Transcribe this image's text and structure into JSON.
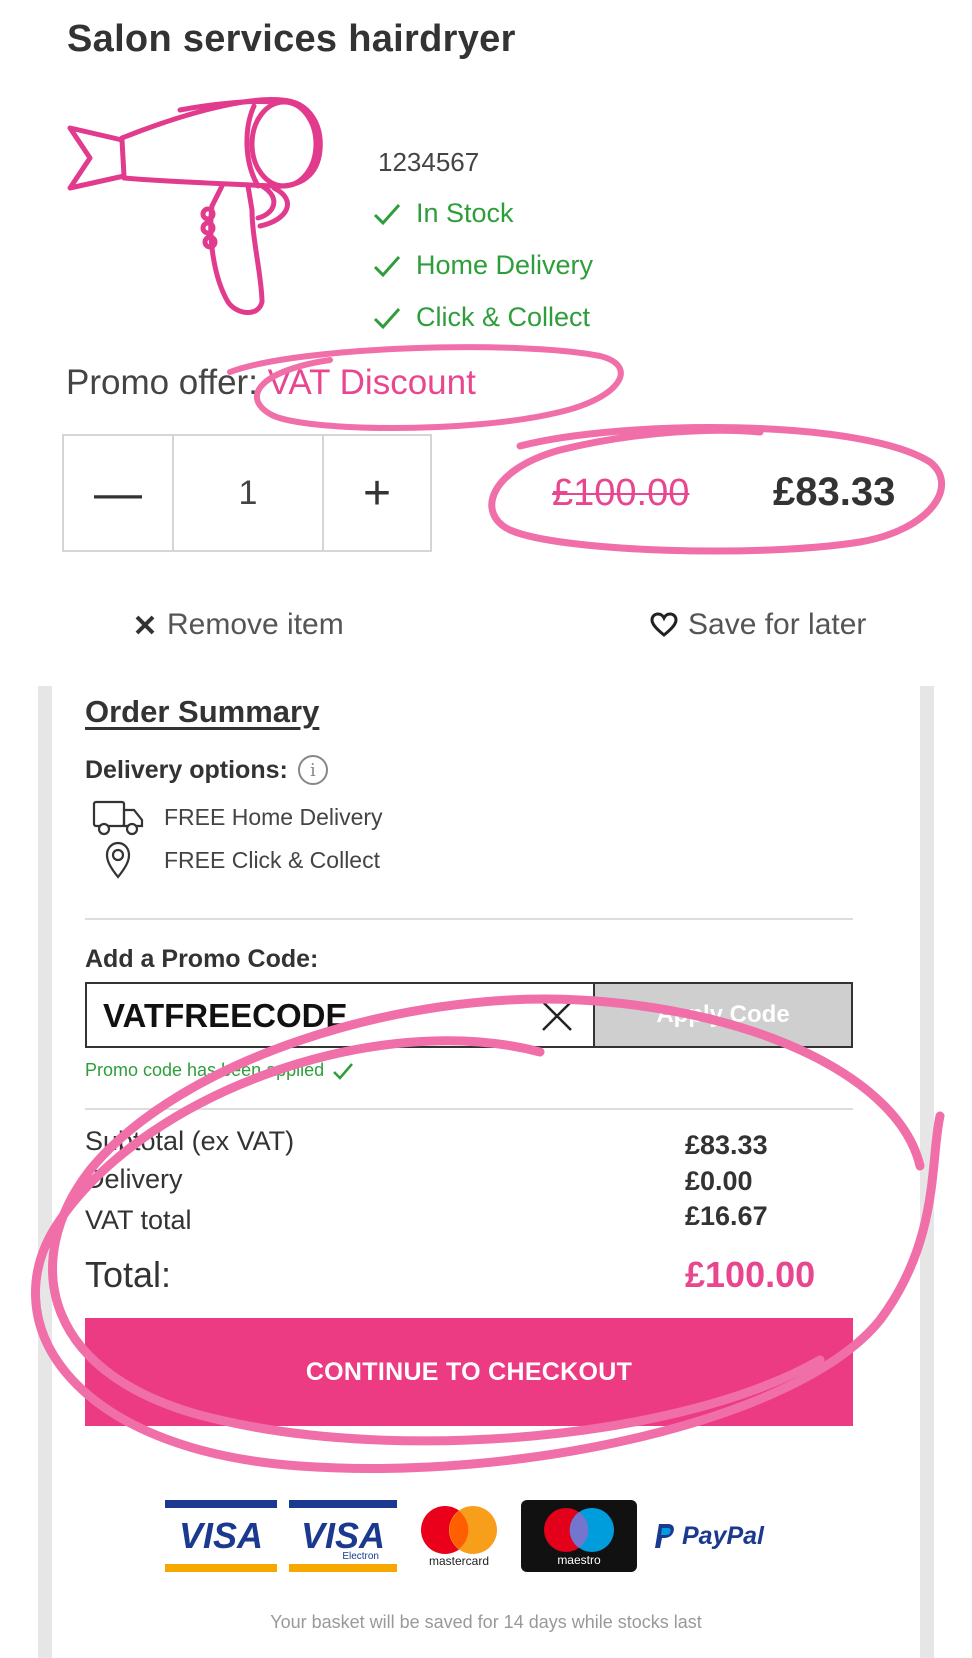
{
  "product": {
    "title": "Salon services hairdryer",
    "sku": "1234567",
    "stock_items": [
      "In Stock",
      "Home Delivery",
      "Click & Collect"
    ],
    "promo_offer_label": "Promo offer: ",
    "promo_offer_value": "VAT Discount",
    "quantity": "1",
    "minus_symbol": "—",
    "plus_symbol": "+",
    "old_price": "£100.00",
    "new_price": "£83.33",
    "remove_label": "Remove item",
    "save_label": "Save for later"
  },
  "summary": {
    "title": "Order Summary",
    "delivery_title": "Delivery options:",
    "info_symbol": "i",
    "delivery_options": [
      "FREE Home Delivery",
      "FREE Click & Collect"
    ],
    "promo_label": "Add a Promo Code:",
    "promo_code_value": "VATFREECODE",
    "apply_label": "Apply Code",
    "promo_status": "Promo code has been applied",
    "subtotal_label": "Subtotal (ex VAT)",
    "subtotal_value": "£83.33",
    "delivery_label": "Delivery",
    "delivery_value": "£0.00",
    "vat_label": "VAT total",
    "vat_value": "£16.67",
    "total_label": "Total:",
    "total_value": "£100.00",
    "checkout_label": "CONTINUE TO CHECKOUT"
  },
  "payment": {
    "visa": "VISA",
    "visa_electron": "VISA",
    "visa_electron_sub": "Electron",
    "mastercard": "mastercard",
    "maestro": "maestro",
    "paypal": "PayPal"
  },
  "basket_note": "Your basket will be saved for 14 days while stocks last",
  "colors": {
    "accent_pink": "#ec3b83",
    "price_pink": "#e8478f",
    "stock_green": "#2e9e3b",
    "annotation_pink": "#f06fa8"
  },
  "icons": [
    "hairdryer-icon",
    "check-icon",
    "close-icon",
    "heart-icon",
    "info-icon",
    "truck-icon",
    "location-pin-icon"
  ]
}
